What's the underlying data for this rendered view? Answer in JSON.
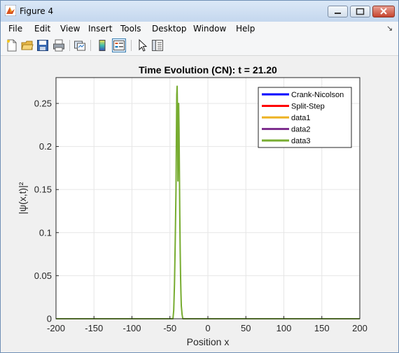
{
  "window": {
    "title": "Figure 4"
  },
  "menu": [
    "File",
    "Edit",
    "View",
    "Insert",
    "Tools",
    "Desktop",
    "Window",
    "Help"
  ],
  "toolbar_icons": [
    "new-figure-icon",
    "open-file-icon",
    "save-icon",
    "print-icon",
    "link-figure-icon",
    "colorbar-icon",
    "legend-icon",
    "edit-plot-icon",
    "property-inspector-icon"
  ],
  "chart_data": {
    "type": "line",
    "title": "Time Evolution (CN): t = 21.20",
    "xlabel": "Position x",
    "ylabel": "|ψ(x,t)|²",
    "xlim": [
      -200,
      200
    ],
    "ylim": [
      0,
      0.28
    ],
    "xticks": [
      -200,
      -150,
      -100,
      -50,
      0,
      50,
      100,
      150,
      200
    ],
    "xtick_labels": [
      "-200",
      "-150",
      "-100",
      "-50",
      "0",
      "50",
      "100",
      "150",
      "200"
    ],
    "yticks": [
      0,
      0.05,
      0.1,
      0.15,
      0.2,
      0.25
    ],
    "ytick_labels": [
      "0",
      "0.05",
      "0.1",
      "0.15",
      "0.2",
      "0.25"
    ],
    "grid": true,
    "legend_position": "top-right",
    "series": [
      {
        "name": "Crank-Nicolson",
        "color": "#0000ff",
        "x": [],
        "y": []
      },
      {
        "name": "Split-Step",
        "color": "#ff0000",
        "x": [],
        "y": []
      },
      {
        "name": "data1",
        "color": "#edb120",
        "x": [],
        "y": []
      },
      {
        "name": "data2",
        "color": "#7e2f8e",
        "x": [],
        "y": []
      },
      {
        "name": "data3",
        "color": "#77ac30",
        "x": [
          -200,
          -46,
          -45,
          -44,
          -43,
          -42,
          -41.5,
          -41,
          -40.5,
          -40,
          -39.5,
          -39,
          -38.5,
          -38,
          -37.5,
          -37,
          -36.5,
          -36,
          -35.5,
          -35,
          -34,
          -33,
          200
        ],
        "y": [
          0,
          0,
          0.01,
          0.04,
          0.09,
          0.15,
          0.21,
          0.26,
          0.27,
          0.24,
          0.16,
          0.21,
          0.25,
          0.22,
          0.17,
          0.12,
          0.08,
          0.05,
          0.03,
          0.015,
          0.005,
          0,
          0
        ]
      }
    ]
  }
}
